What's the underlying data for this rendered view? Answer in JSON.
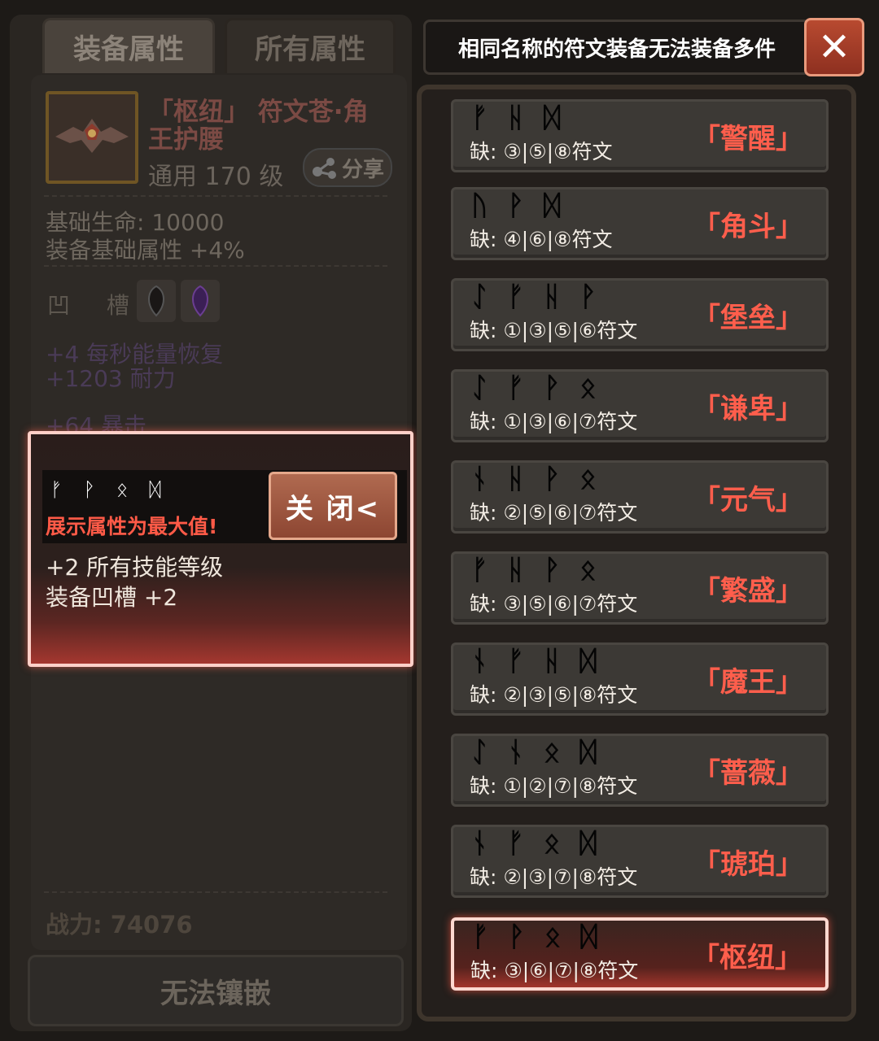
{
  "tabs": {
    "equip_attr": "装备属性",
    "all_attr": "所有属性"
  },
  "item": {
    "name_line1": "「枢纽」 符文苍·角",
    "name_line2": "王护腰",
    "level": "通用 170 级",
    "share_label": "分享"
  },
  "stats": {
    "base_hp": "基础生命: 10000",
    "base_attr": "装备基础属性 +4%"
  },
  "socket": {
    "label": "凹 槽:"
  },
  "purple_stats": [
    "+4 每秒能量恢复",
    "+1203 耐力",
    "+64 暴击"
  ],
  "power": "战力: 74076",
  "inlay_button": "无法镶嵌",
  "popup": {
    "runes": [
      "ᚠ",
      "ᚹ",
      "ᛟ",
      "ᛞ"
    ],
    "max_note": "展示属性为最大值!",
    "close_label": "关 闭<",
    "lines": [
      "+2 所有技能等级",
      "装备凹槽 +2"
    ]
  },
  "message": "相同名称的符文装备无法装备多件",
  "close_x": "✕",
  "sets": [
    {
      "name": "「警醒」",
      "runes": [
        "ᚠ",
        "ᚺ",
        "ᛞ"
      ],
      "missing": "缺: ③|⑤|⑧符文"
    },
    {
      "name": "「角斗」",
      "runes": [
        "ᚢ",
        "ᚹ",
        "ᛞ"
      ],
      "missing": "缺: ④|⑥|⑧符文"
    },
    {
      "name": "「堡垒」",
      "runes": [
        "ᛇ",
        "ᚠ",
        "ᚺ",
        "ᚹ"
      ],
      "missing": "缺: ①|③|⑤|⑥符文"
    },
    {
      "name": "「谦卑」",
      "runes": [
        "ᛇ",
        "ᚠ",
        "ᚹ",
        "ᛟ"
      ],
      "missing": "缺: ①|③|⑥|⑦符文"
    },
    {
      "name": "「元气」",
      "runes": [
        "ᚾ",
        "ᚺ",
        "ᚹ",
        "ᛟ"
      ],
      "missing": "缺: ②|⑤|⑥|⑦符文"
    },
    {
      "name": "「繁盛」",
      "runes": [
        "ᚠ",
        "ᚺ",
        "ᚹ",
        "ᛟ"
      ],
      "missing": "缺: ③|⑤|⑥|⑦符文"
    },
    {
      "name": "「魔王」",
      "runes": [
        "ᚾ",
        "ᚠ",
        "ᚺ",
        "ᛞ"
      ],
      "missing": "缺: ②|③|⑤|⑧符文"
    },
    {
      "name": "「蔷薇」",
      "runes": [
        "ᛇ",
        "ᚾ",
        "ᛟ",
        "ᛞ"
      ],
      "missing": "缺: ①|②|⑦|⑧符文"
    },
    {
      "name": "「琥珀」",
      "runes": [
        "ᚾ",
        "ᚠ",
        "ᛟ",
        "ᛞ"
      ],
      "missing": "缺: ②|③|⑦|⑧符文"
    },
    {
      "name": "「枢纽」",
      "runes": [
        "ᚠ",
        "ᚹ",
        "ᛟ",
        "ᛞ"
      ],
      "missing": "缺: ③|⑥|⑦|⑧符文",
      "active": true
    }
  ],
  "colors": {
    "accent_red": "#ff5e4c",
    "gold_frame": "#6f5524"
  }
}
